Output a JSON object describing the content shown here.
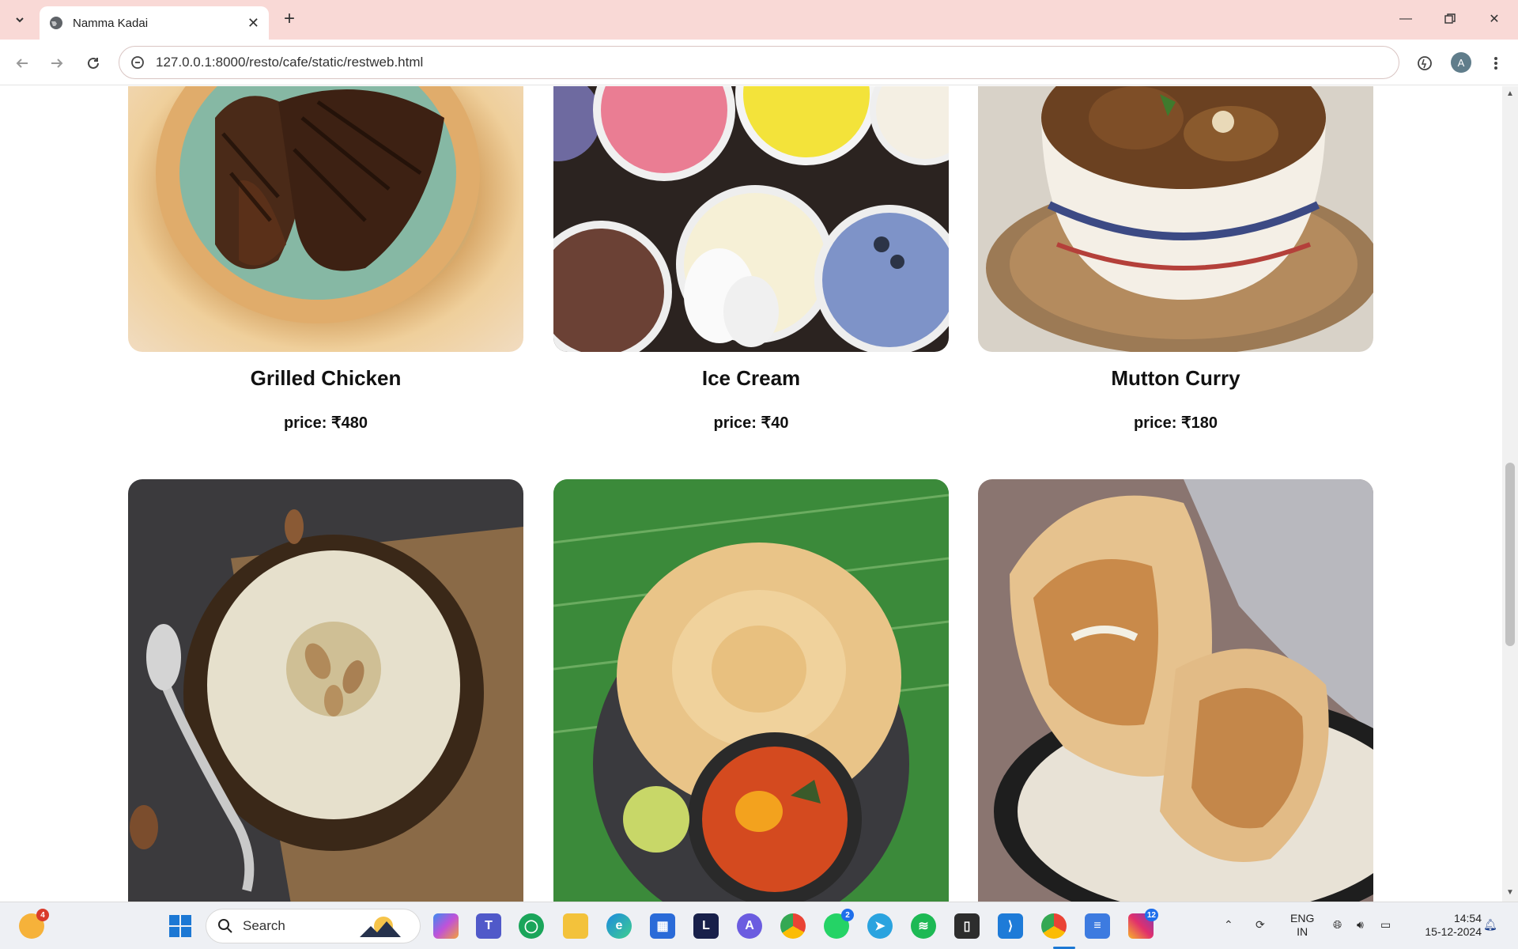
{
  "browser": {
    "tab_title": "Namma Kadai",
    "url": "127.0.0.1:8000/resto/cafe/static/restweb.html",
    "profile_initial": "A"
  },
  "menu": {
    "price_prefix": "price: ",
    "row1": [
      {
        "name": "Grilled Chicken",
        "price": "price: ₹480",
        "image": "grilled-chicken-image"
      },
      {
        "name": "Ice Cream",
        "price": "price: ₹40",
        "image": "ice-cream-image"
      },
      {
        "name": "Mutton Curry",
        "price": "price: ₹180",
        "image": "mutton-curry-image"
      }
    ],
    "row2": [
      {
        "image": "kheer-image"
      },
      {
        "image": "parotta-image"
      },
      {
        "image": "shawarma-image"
      }
    ]
  },
  "taskbar": {
    "search_placeholder": "Search",
    "weather_badge": "4",
    "whatsapp_badge": "2",
    "instagram_badge": "12",
    "language_line1": "ENG",
    "language_line2": "IN",
    "time": "14:54",
    "date": "15-12-2024",
    "launcher_letter": "L"
  },
  "colors": {
    "tabstrip": "#f9d9d6",
    "taskbar": "#eef0f4"
  }
}
